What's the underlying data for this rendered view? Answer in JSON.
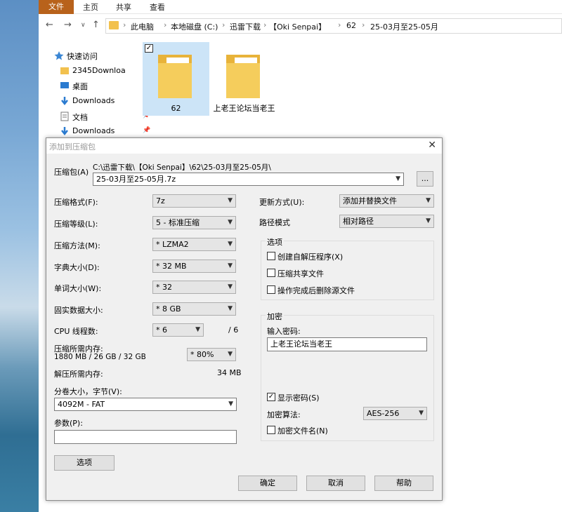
{
  "explorer": {
    "ribbon_tabs": [
      "文件",
      "主页",
      "共享",
      "查看"
    ],
    "breadcrumbs": [
      "此电脑",
      "本地磁盘 (C:)",
      "迅雷下载",
      "【Oki Senpai】",
      "62",
      "25-03月至25-05月"
    ],
    "nav": [
      {
        "label": "快速访问"
      },
      {
        "label": "2345Downloa"
      },
      {
        "label": "桌面"
      },
      {
        "label": "Downloads"
      },
      {
        "label": "文档"
      },
      {
        "label": "Downloads"
      }
    ],
    "items": [
      {
        "label": "62"
      },
      {
        "label": "上老王论坛当老王"
      }
    ]
  },
  "dialog": {
    "title": "添加到压缩包",
    "archive_label": "压缩包(A)",
    "archive_path": "C:\\迅雷下载\\【Oki Senpai】\\62\\25-03月至25-05月\\",
    "archive_name": "25-03月至25-05月.7z",
    "browse_label": "...",
    "format_label": "压缩格式(F):",
    "format_value": "7z",
    "level_label": "压缩等级(L):",
    "level_value": "5 - 标准压缩",
    "method_label": "压缩方法(M):",
    "method_value": "* LZMA2",
    "dict_label": "字典大小(D):",
    "dict_value": "* 32 MB",
    "word_label": "单词大小(W):",
    "word_value": "* 32",
    "solid_label": "固实数据大小:",
    "solid_value": "* 8 GB",
    "threads_label": "CPU 线程数:",
    "threads_value": "* 6",
    "threads_max": "/ 6",
    "mem_label": "压缩所需内存:",
    "mem_value": "1880 MB / 26 GB / 32 GB",
    "mem_pct": "* 80%",
    "decomp_label": "解压所需内存:",
    "decomp_value": "34 MB",
    "split_label": "分卷大小，字节(V):",
    "split_value": "4092M - FAT",
    "params_label": "参数(P):",
    "params_value": "",
    "options_button": "选项",
    "update_label": "更新方式(U):",
    "update_value": "添加并替换文件",
    "path_label": "路径模式",
    "path_value": "相对路径",
    "options_group": "选项",
    "opt_sfx": "创建自解压程序(X)",
    "opt_shared": "压缩共享文件",
    "opt_delete": "操作完成后删除源文件",
    "enc_group": "加密",
    "pwd_label": "输入密码:",
    "pwd_value": "上老王论坛当老王",
    "show_pwd": "显示密码(S)",
    "enc_method_label": "加密算法:",
    "enc_method_value": "AES-256",
    "enc_names": "加密文件名(N)",
    "ok": "确定",
    "cancel": "取消",
    "help": "帮助"
  },
  "colors": {
    "file_tab": "#b8621b",
    "folder": "#f2c14e",
    "selected": "#cce4f7",
    "dialog_bg": "#f0f0f0"
  }
}
